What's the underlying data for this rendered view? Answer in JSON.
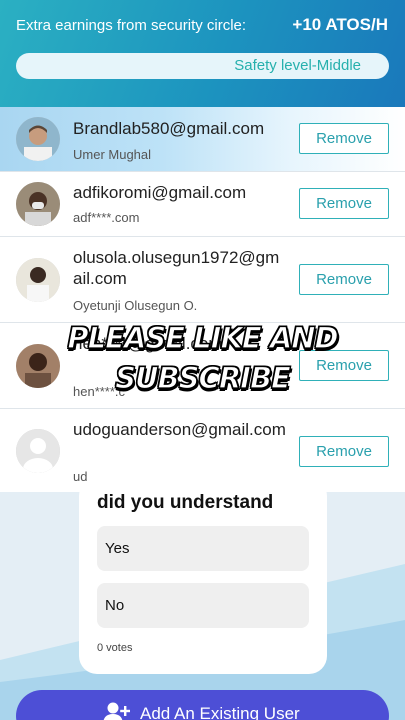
{
  "header": {
    "earnings_label": "Extra earnings from security circle:",
    "earnings_value": "+10 ATOS/H",
    "safety_level": "Safety level-Middle"
  },
  "members": [
    {
      "email": "Brandlab580@gmail.com",
      "name": "Umer Mughal",
      "action": "Remove"
    },
    {
      "email": "adfikoromi@gmail.com",
      "name": "adf****.com",
      "action": "Remove"
    },
    {
      "email": "olusola.olusegun1972@gmail.com",
      "name": "Oyetunji Olusegun O.",
      "action": "Remove"
    },
    {
      "email": "hen****@gmail.com",
      "name": "hen****.c",
      "action": "Remove"
    },
    {
      "email": "udoguanderson@gmail.com",
      "name": "ud",
      "action": "Remove"
    }
  ],
  "overlay_text": "PLEASE LIKE AND SUBSCRIBE",
  "poll": {
    "question": "did you understand",
    "options": [
      "Yes",
      "No"
    ],
    "votes": "0 votes"
  },
  "add_button": {
    "label": "Add An Existing User",
    "icon": "add-user-icon"
  },
  "colors": {
    "header_start": "#2bb0c2",
    "header_end": "#1a78bb",
    "accent_teal": "#2fb0b8",
    "button_blue": "#4d4fd6"
  }
}
